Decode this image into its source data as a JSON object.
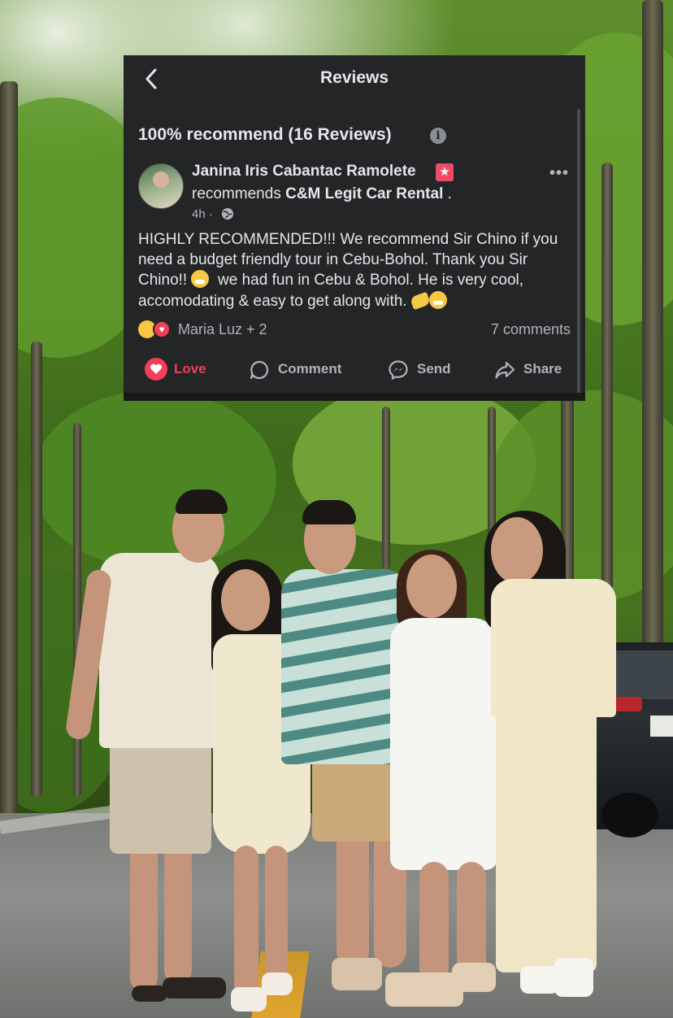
{
  "header": {
    "title": "Reviews",
    "back_icon": "chevron-left-icon"
  },
  "summary": {
    "text": "100% recommend (16 Reviews)",
    "info_icon": "info-icon"
  },
  "review": {
    "author": "Janina Iris Cabantac Ramolete",
    "recommends_prefix": "recommends ",
    "page_name": "C&M Legit Car Rental",
    "recommends_suffix": " .",
    "time": "4h ·",
    "text_part1": "HIGHLY RECOMMENDED!!! We recommend Sir Chino if you need a budget friendly tour in Cebu-Bohol. Thank you Sir Chino!!",
    "text_part2": "we had fun in Cebu & Bohol. He is very cool, accomodating & easy to get along with.",
    "reactors": "Maria Luz + 2",
    "comments": "7 comments"
  },
  "actions": {
    "love": "Love",
    "comment": "Comment",
    "send": "Send",
    "share": "Share"
  },
  "colors": {
    "card_bg": "#242526",
    "text_primary": "#e4e6eb",
    "text_secondary": "#b0b3b8",
    "love_red": "#f33e58"
  }
}
